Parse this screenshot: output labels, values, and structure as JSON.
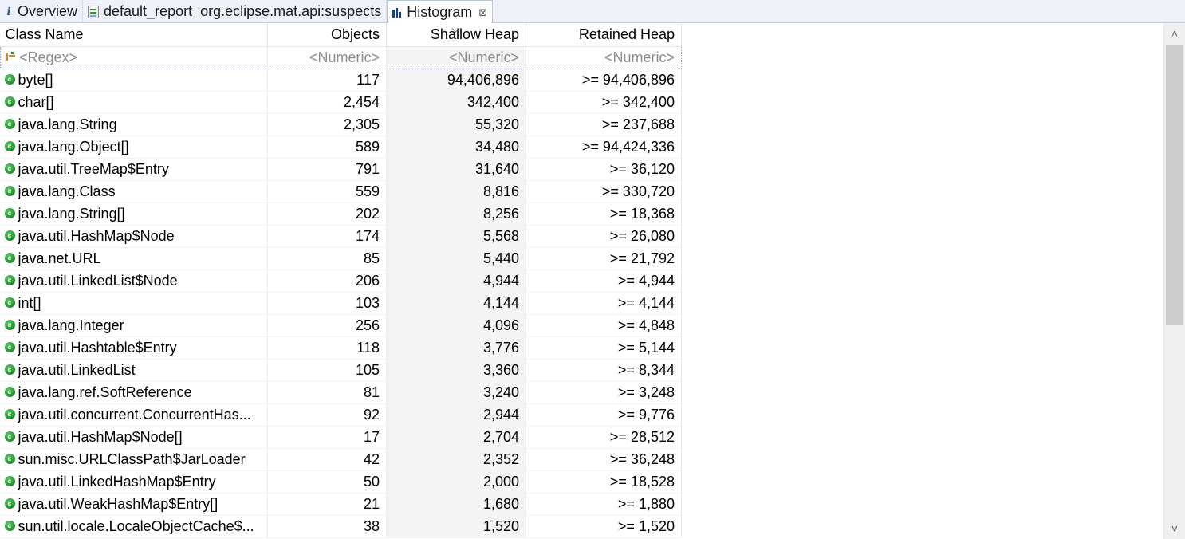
{
  "tabs": [
    {
      "label": "Overview",
      "icon": "info-icon"
    },
    {
      "label": "default_report  org.eclipse.mat.api:suspects",
      "icon": "report-icon"
    },
    {
      "label": "Histogram",
      "icon": "histogram-icon",
      "close": "⊠"
    }
  ],
  "columns": [
    "Class Name",
    "Objects",
    "Shallow Heap",
    "Retained Heap"
  ],
  "filter": {
    "name": "<Regex>",
    "objects": "<Numeric>",
    "shallow": "<Numeric>",
    "retained": "<Numeric>"
  },
  "rows": [
    {
      "name": "byte[]",
      "objects": "117",
      "shallow": "94,406,896",
      "retained": ">= 94,406,896"
    },
    {
      "name": "char[]",
      "objects": "2,454",
      "shallow": "342,400",
      "retained": ">= 342,400"
    },
    {
      "name": "java.lang.String",
      "objects": "2,305",
      "shallow": "55,320",
      "retained": ">= 237,688"
    },
    {
      "name": "java.lang.Object[]",
      "objects": "589",
      "shallow": "34,480",
      "retained": ">= 94,424,336"
    },
    {
      "name": "java.util.TreeMap$Entry",
      "objects": "791",
      "shallow": "31,640",
      "retained": ">= 36,120"
    },
    {
      "name": "java.lang.Class",
      "objects": "559",
      "shallow": "8,816",
      "retained": ">= 330,720"
    },
    {
      "name": "java.lang.String[]",
      "objects": "202",
      "shallow": "8,256",
      "retained": ">= 18,368"
    },
    {
      "name": "java.util.HashMap$Node",
      "objects": "174",
      "shallow": "5,568",
      "retained": ">= 26,080"
    },
    {
      "name": "java.net.URL",
      "objects": "85",
      "shallow": "5,440",
      "retained": ">= 21,792"
    },
    {
      "name": "java.util.LinkedList$Node",
      "objects": "206",
      "shallow": "4,944",
      "retained": ">= 4,944"
    },
    {
      "name": "int[]",
      "objects": "103",
      "shallow": "4,144",
      "retained": ">= 4,144"
    },
    {
      "name": "java.lang.Integer",
      "objects": "256",
      "shallow": "4,096",
      "retained": ">= 4,848"
    },
    {
      "name": "java.util.Hashtable$Entry",
      "objects": "118",
      "shallow": "3,776",
      "retained": ">= 5,144"
    },
    {
      "name": "java.util.LinkedList",
      "objects": "105",
      "shallow": "3,360",
      "retained": ">= 8,344"
    },
    {
      "name": "java.lang.ref.SoftReference",
      "objects": "81",
      "shallow": "3,240",
      "retained": ">= 3,248"
    },
    {
      "name": "java.util.concurrent.ConcurrentHas...",
      "objects": "92",
      "shallow": "2,944",
      "retained": ">= 9,776"
    },
    {
      "name": "java.util.HashMap$Node[]",
      "objects": "17",
      "shallow": "2,704",
      "retained": ">= 28,512"
    },
    {
      "name": "sun.misc.URLClassPath$JarLoader",
      "objects": "42",
      "shallow": "2,352",
      "retained": ">= 36,248"
    },
    {
      "name": "java.util.LinkedHashMap$Entry",
      "objects": "50",
      "shallow": "2,000",
      "retained": ">= 18,528"
    },
    {
      "name": "java.util.WeakHashMap$Entry[]",
      "objects": "21",
      "shallow": "1,680",
      "retained": ">= 1,880"
    },
    {
      "name": "sun.util.locale.LocaleObjectCache$...",
      "objects": "38",
      "shallow": "1,520",
      "retained": ">= 1,520"
    }
  ],
  "row_icon": "class-icon",
  "sorted_column": "Shallow Heap",
  "colors": {
    "class_icon": "#2e9a35",
    "tabbar_bg": "#eef2f8",
    "filter_text": "#8c8c8c"
  }
}
